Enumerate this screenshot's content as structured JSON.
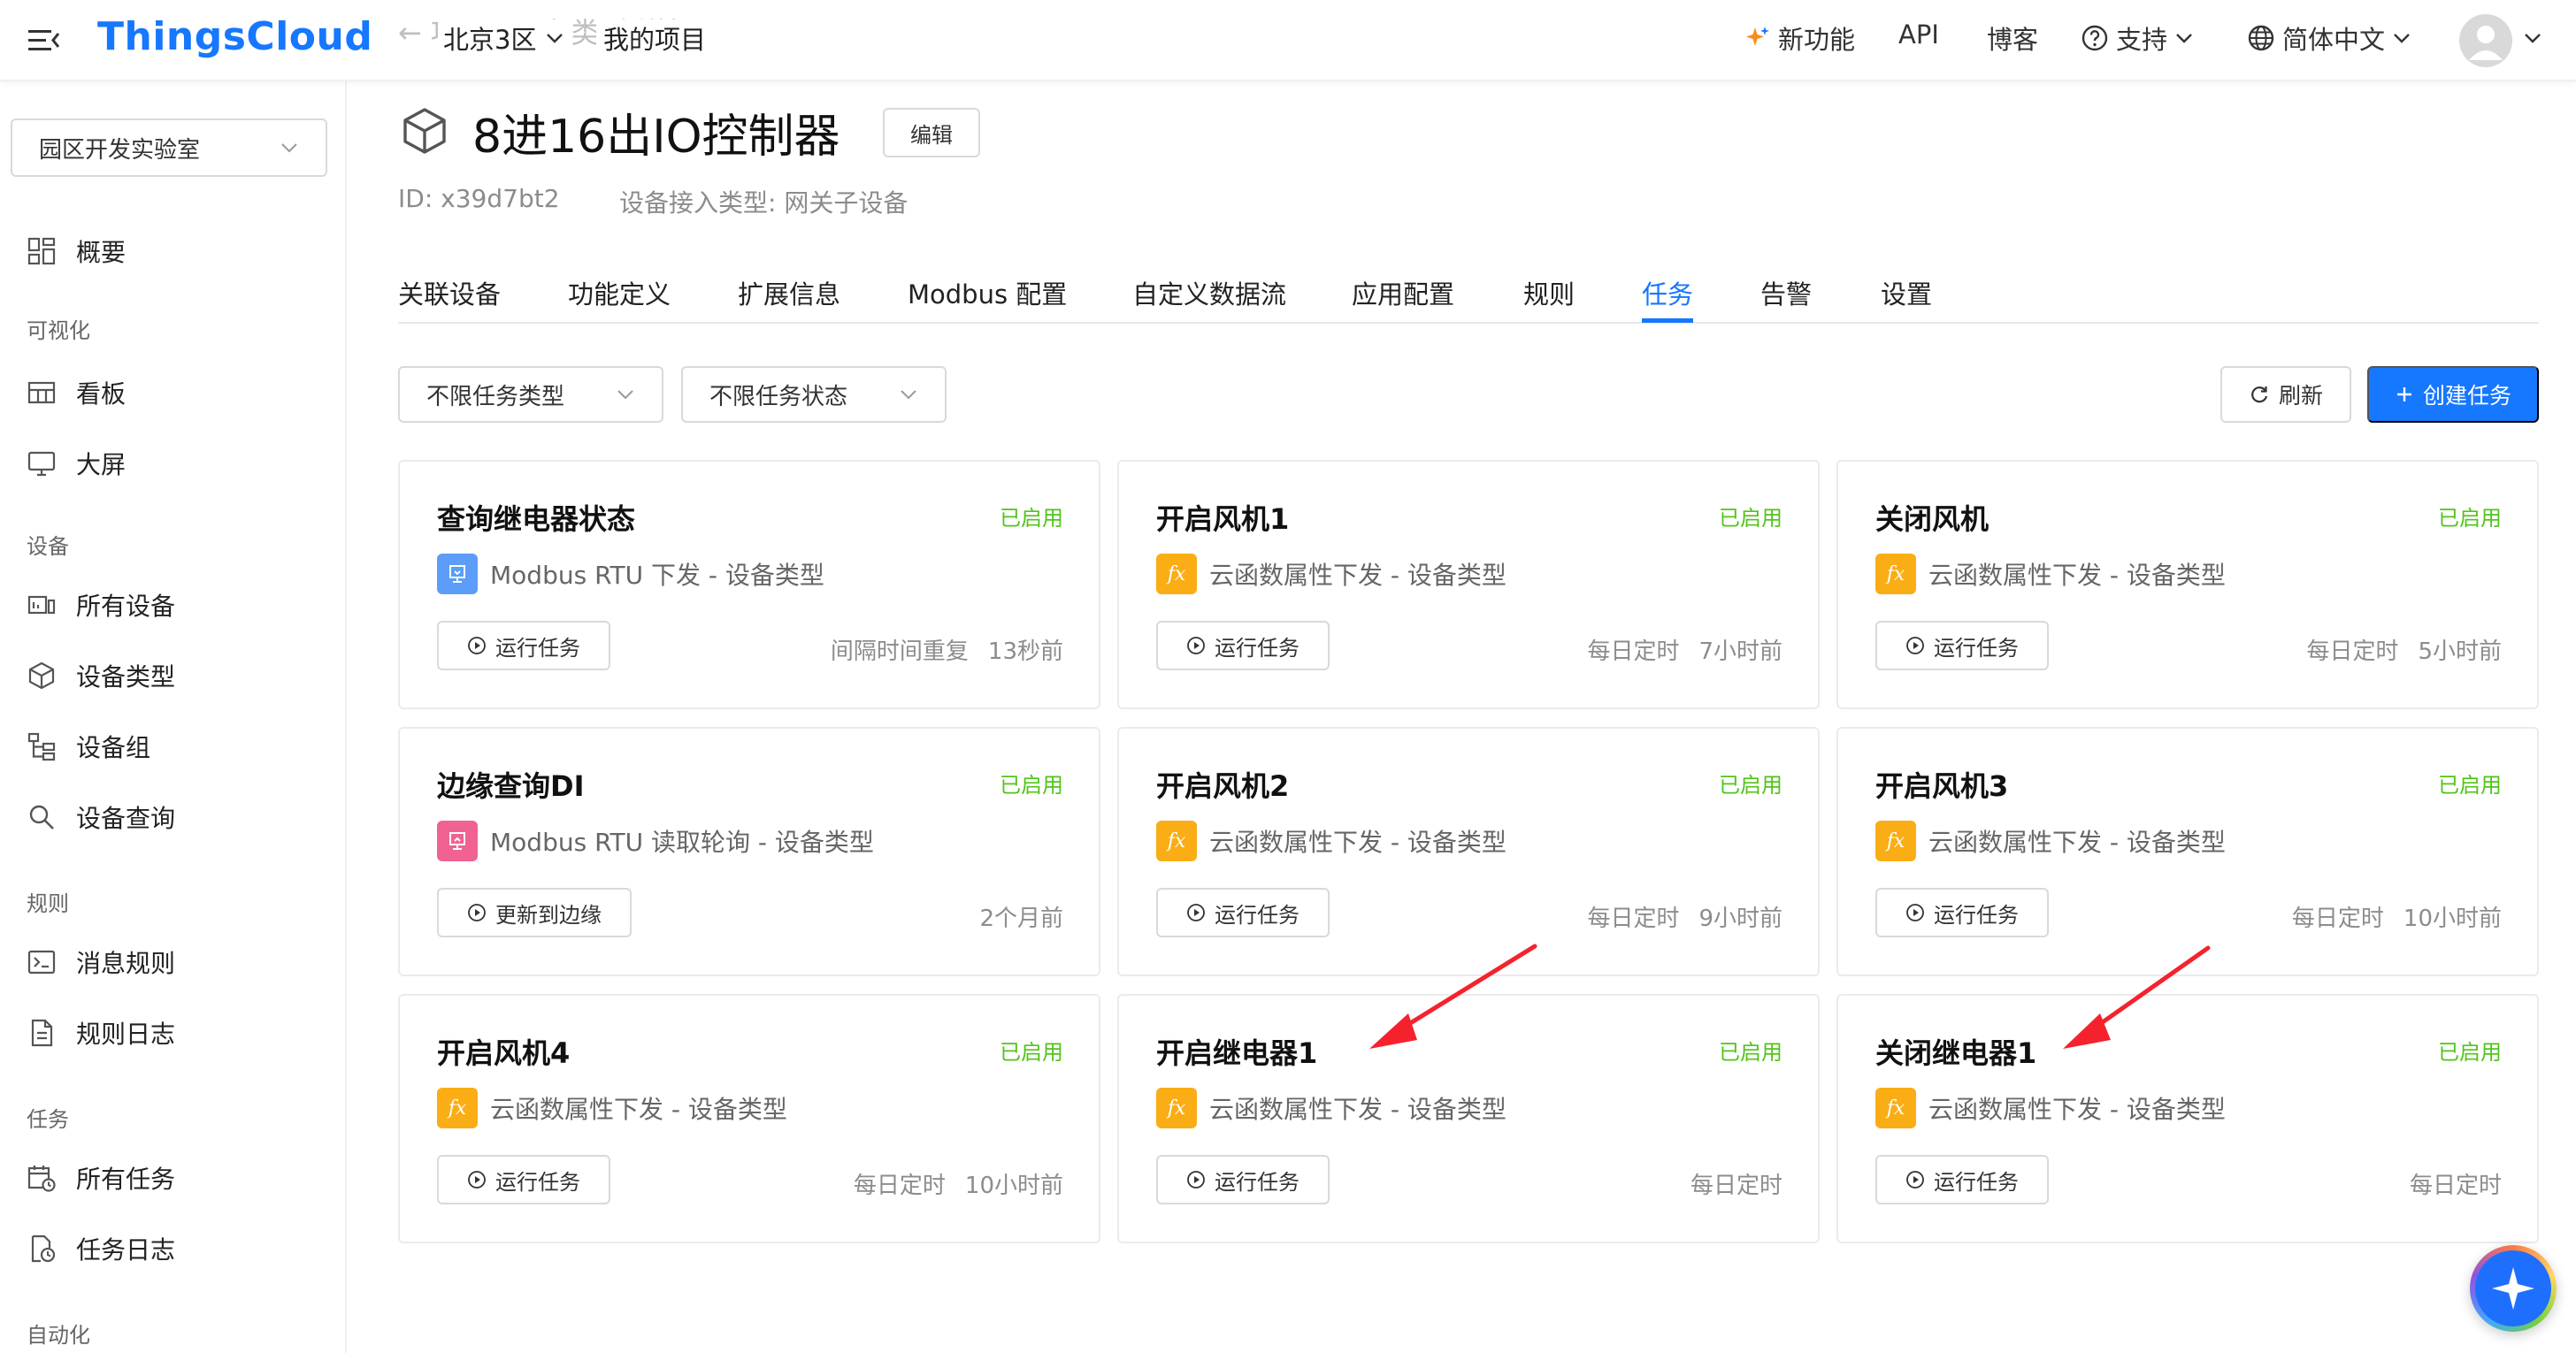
{
  "header": {
    "logo": "ThingsCloud",
    "breadcrumb_ghost": "← 项目 · 设备类型详情",
    "region": "北京3区",
    "project": "我的项目",
    "new_feature": "新功能",
    "api": "API",
    "blog": "博客",
    "support": "支持",
    "language": "简体中文"
  },
  "sidebar": {
    "lab_select": "园区开发实验室",
    "overview": "概要",
    "group_visual": "可视化",
    "dashboard": "看板",
    "bigscreen": "大屏",
    "group_device": "设备",
    "all_devices": "所有设备",
    "device_types": "设备类型",
    "device_groups": "设备组",
    "device_query": "设备查询",
    "group_rules": "规则",
    "message_rules": "消息规则",
    "rule_logs": "规则日志",
    "group_tasks": "任务",
    "all_tasks": "所有任务",
    "task_logs": "任务日志",
    "group_automation": "自动化"
  },
  "page": {
    "title": "8进16出IO控制器",
    "edit": "编辑",
    "id_label": "ID: x39d7bt2",
    "access_type": "设备接入类型: 网关子设备"
  },
  "tabs": [
    "关联设备",
    "功能定义",
    "扩展信息",
    "Modbus 配置",
    "自定义数据流",
    "应用配置",
    "规则",
    "任务",
    "告警",
    "设置"
  ],
  "active_tab": "任务",
  "toolbar": {
    "task_type_filter": "不限任务类型",
    "task_status_filter": "不限任务状态",
    "refresh": "刷新",
    "create": "创建任务"
  },
  "colors": {
    "primary": "#1677ff",
    "enabled": "#52c41a",
    "fx_icon": "#faad14",
    "rtu_icon": "#5b9df9",
    "poll_icon": "#f06292",
    "arrow": "#f5222d"
  },
  "cards": [
    {
      "title": "查询继电器状态",
      "status": "已启用",
      "icon": "modbus-rtu-icon",
      "type": "Modbus RTU 下发 - 设备类型",
      "button": "运行任务",
      "schedule": "间隔时间重复",
      "time": "13秒前"
    },
    {
      "title": "开启风机1",
      "status": "已启用",
      "icon": "cloud-function-icon",
      "type": "云函数属性下发 - 设备类型",
      "button": "运行任务",
      "schedule": "每日定时",
      "time": "7小时前"
    },
    {
      "title": "关闭风机",
      "status": "已启用",
      "icon": "cloud-function-icon",
      "type": "云函数属性下发 - 设备类型",
      "button": "运行任务",
      "schedule": "每日定时",
      "time": "5小时前"
    },
    {
      "title": "边缘查询DI",
      "status": "已启用",
      "icon": "modbus-poll-icon",
      "type": "Modbus RTU 读取轮询 - 设备类型",
      "button": "更新到边缘",
      "schedule": "",
      "time": "2个月前"
    },
    {
      "title": "开启风机2",
      "status": "已启用",
      "icon": "cloud-function-icon",
      "type": "云函数属性下发 - 设备类型",
      "button": "运行任务",
      "schedule": "每日定时",
      "time": "9小时前"
    },
    {
      "title": "开启风机3",
      "status": "已启用",
      "icon": "cloud-function-icon",
      "type": "云函数属性下发 - 设备类型",
      "button": "运行任务",
      "schedule": "每日定时",
      "time": "10小时前"
    },
    {
      "title": "开启风机4",
      "status": "已启用",
      "icon": "cloud-function-icon",
      "type": "云函数属性下发 - 设备类型",
      "button": "运行任务",
      "schedule": "每日定时",
      "time": "10小时前"
    },
    {
      "title": "开启继电器1",
      "status": "已启用",
      "icon": "cloud-function-icon",
      "type": "云函数属性下发 - 设备类型",
      "button": "运行任务",
      "schedule": "每日定时",
      "time": ""
    },
    {
      "title": "关闭继电器1",
      "status": "已启用",
      "icon": "cloud-function-icon",
      "type": "云函数属性下发 - 设备类型",
      "button": "运行任务",
      "schedule": "每日定时",
      "time": ""
    }
  ]
}
